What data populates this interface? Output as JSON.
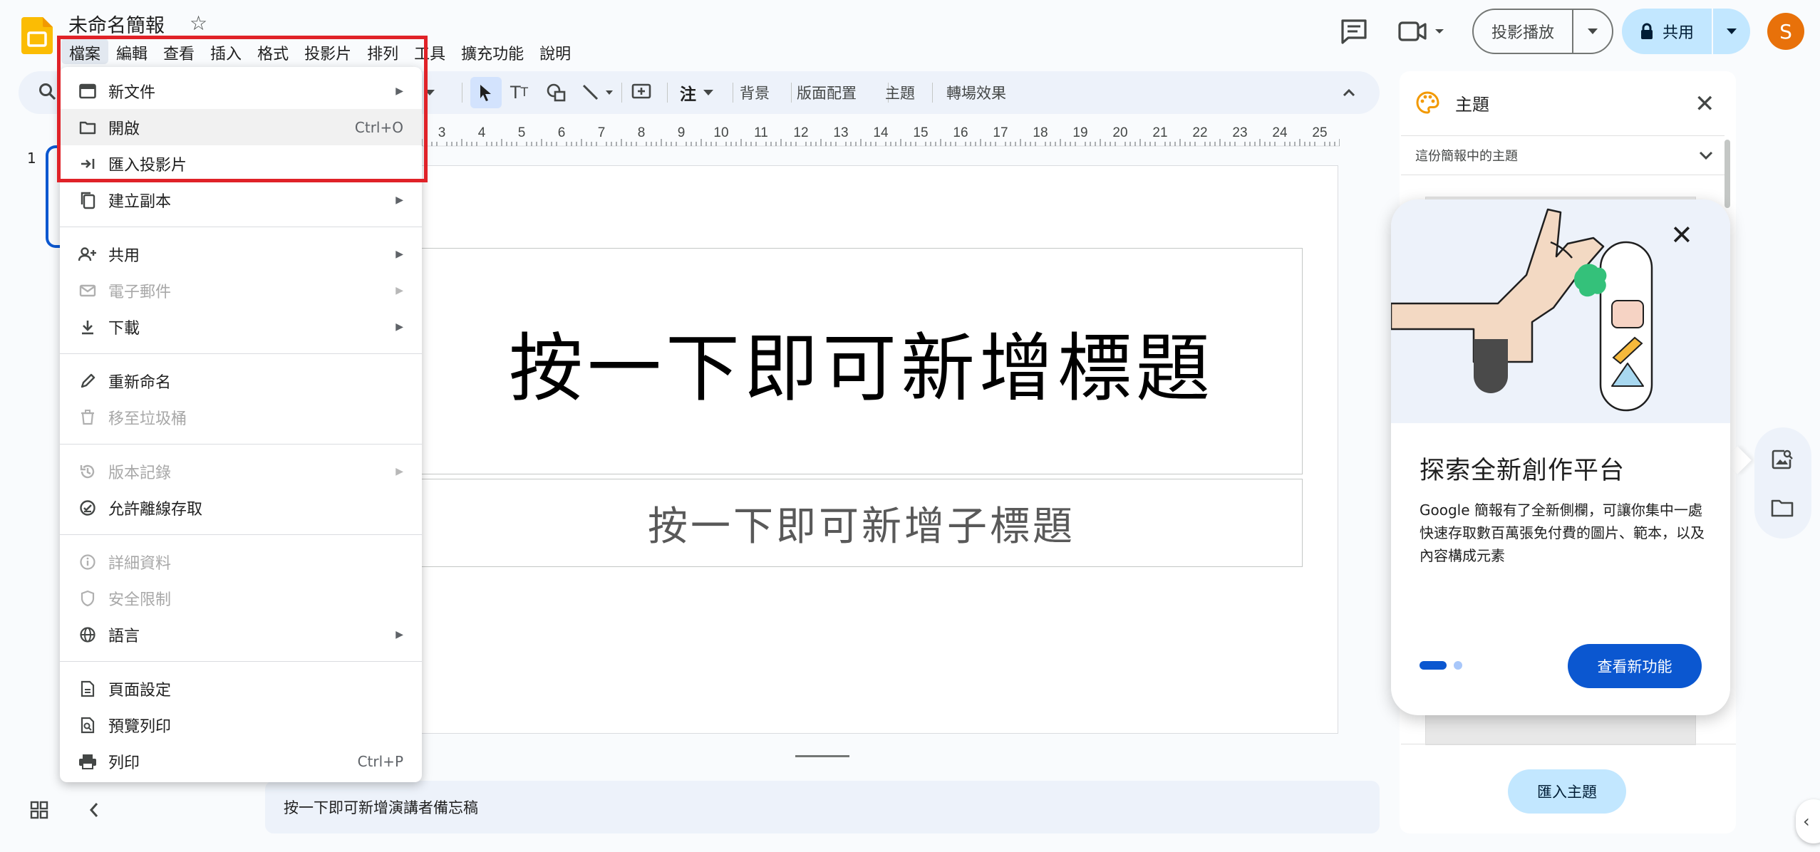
{
  "app": {
    "title": "未命名簡報",
    "menus": [
      "檔案",
      "編輯",
      "查看",
      "插入",
      "格式",
      "投影片",
      "排列",
      "工具",
      "擴充功能",
      "說明"
    ],
    "active_menu": "檔案"
  },
  "header": {
    "present_label": "投影播放",
    "share_label": "共用",
    "avatar_initial": "S",
    "avatar_color": "#e8710a"
  },
  "toolbar": {
    "comment_label": "注",
    "background_label": "背景",
    "layout_label": "版面配置",
    "theme_label": "主題",
    "transition_label": "轉場效果"
  },
  "ruler": {
    "ticks": [
      "3",
      "4",
      "5",
      "6",
      "7",
      "8",
      "9",
      "10",
      "11",
      "12",
      "13",
      "14",
      "15",
      "16",
      "17",
      "18",
      "19",
      "20",
      "21",
      "22",
      "23",
      "24",
      "25"
    ]
  },
  "filmstrip": {
    "slide_number": "1"
  },
  "slide": {
    "title_placeholder": "按一下即可新增標題",
    "subtitle_placeholder": "按一下即可新增子標題"
  },
  "notes": {
    "placeholder": "按一下即可新增演講者備忘稿"
  },
  "file_menu": {
    "items": [
      {
        "label": "新文件",
        "icon": "new-doc-icon",
        "submenu": true
      },
      {
        "label": "開啟",
        "icon": "folder-icon",
        "shortcut": "Ctrl+O"
      },
      {
        "label": "匯入投影片",
        "icon": "import-icon"
      },
      {
        "label": "建立副本",
        "icon": "copy-icon",
        "submenu": true
      },
      {
        "label": "共用",
        "icon": "person-add-icon",
        "submenu": true
      },
      {
        "label": "電子郵件",
        "icon": "mail-icon",
        "submenu": true,
        "disabled": true
      },
      {
        "label": "下載",
        "icon": "download-icon",
        "submenu": true
      },
      {
        "label": "重新命名",
        "icon": "pencil-icon"
      },
      {
        "label": "移至垃圾桶",
        "icon": "trash-icon",
        "disabled": true
      },
      {
        "label": "版本記錄",
        "icon": "history-icon",
        "submenu": true,
        "disabled": true
      },
      {
        "label": "允許離線存取",
        "icon": "offline-icon"
      },
      {
        "label": "詳細資料",
        "icon": "info-icon",
        "disabled": true
      },
      {
        "label": "安全限制",
        "icon": "shield-icon",
        "disabled": true
      },
      {
        "label": "語言",
        "icon": "globe-icon",
        "submenu": true
      },
      {
        "label": "頁面設定",
        "icon": "page-icon"
      },
      {
        "label": "預覽列印",
        "icon": "print-preview-icon"
      },
      {
        "label": "列印",
        "icon": "print-icon",
        "shortcut": "Ctrl+P"
      }
    ],
    "highlight_color": "#e02228"
  },
  "theme_panel": {
    "title": "主題",
    "dropdown_label": "這份簡報中的主題",
    "import_button": "匯入主題"
  },
  "promo": {
    "title": "探索全新創作平台",
    "body": "Google 簡報有了全新側欄，可讓你集中一處快速存取數百萬張免付費的圖片、範本，以及內容構成元素",
    "cta": "查看新功能",
    "accent": "#0b57d0"
  }
}
